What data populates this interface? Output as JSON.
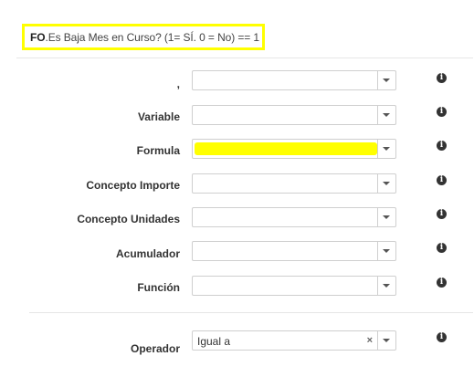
{
  "header": {
    "prefix": "FO",
    "text": ".Es Baja Mes en Curso? (1= SÍ. 0 = No) == 1"
  },
  "rows": [
    {
      "label": ",",
      "value": ""
    },
    {
      "label": "Variable",
      "value": ""
    },
    {
      "label": "Formula",
      "value": ""
    },
    {
      "label": "Concepto Importe",
      "value": ""
    },
    {
      "label": "Concepto Unidades",
      "value": ""
    },
    {
      "label": "Acumulador",
      "value": ""
    },
    {
      "label": "Función",
      "value": ""
    }
  ],
  "operator": {
    "label": "Operador",
    "value": "Igual a",
    "clear_symbol": "×"
  },
  "icons": {
    "info": "i",
    "info_name": "info-icon",
    "dropdown_name": "chevron-down-icon"
  },
  "colors": {
    "highlight": "#ffff00"
  }
}
